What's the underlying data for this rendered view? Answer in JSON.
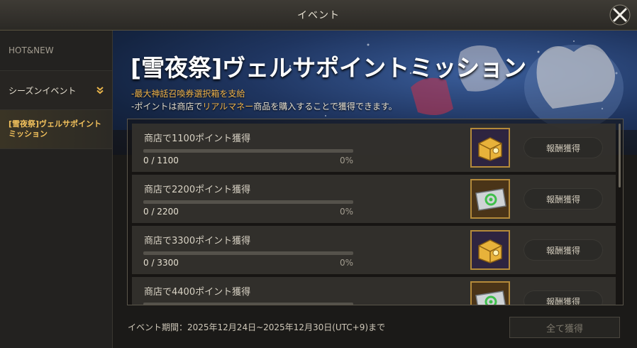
{
  "window": {
    "title": "イベント"
  },
  "sidebar": {
    "header": "HOT&NEW",
    "category": "シーズンイベント",
    "items": [
      {
        "label": "[雪夜祭]ヴェルサポイント\nミッション"
      }
    ]
  },
  "banner": {
    "title": "[雪夜祭]ヴェルサポイントミッション",
    "desc1": "-最大神話召喚券選択箱を支給",
    "desc2_pre": "-ポイントは商店で",
    "desc2_hl": "リアルマネー",
    "desc2_post": "商品を購入することで獲得できます。"
  },
  "missions": [
    {
      "title": "商店で1100ポイント獲得",
      "count": "0 / 1100",
      "percent": "0%",
      "progress": 0,
      "reward_icon": "gold-chest-icon",
      "button": "報酬獲得"
    },
    {
      "title": "商店で2200ポイント獲得",
      "count": "0 / 2200",
      "percent": "0%",
      "progress": 0,
      "reward_icon": "silver-ticket-icon",
      "button": "報酬獲得"
    },
    {
      "title": "商店で3300ポイント獲得",
      "count": "0 / 3300",
      "percent": "0%",
      "progress": 0,
      "reward_icon": "gold-chest-icon",
      "button": "報酬獲得"
    },
    {
      "title": "商店で4400ポイント獲得",
      "count": "",
      "percent": "",
      "progress": 0,
      "reward_icon": "silver-ticket-icon",
      "button": "報酬獲得"
    }
  ],
  "footer": {
    "period": "イベント期間：2025年12月24日~2025年12月30日(UTC+9)まで",
    "claim_all": "全て獲得"
  },
  "colors": {
    "accent": "#f2c15c",
    "desc_highlight": "#f0b44c",
    "panel": "#34322e"
  }
}
